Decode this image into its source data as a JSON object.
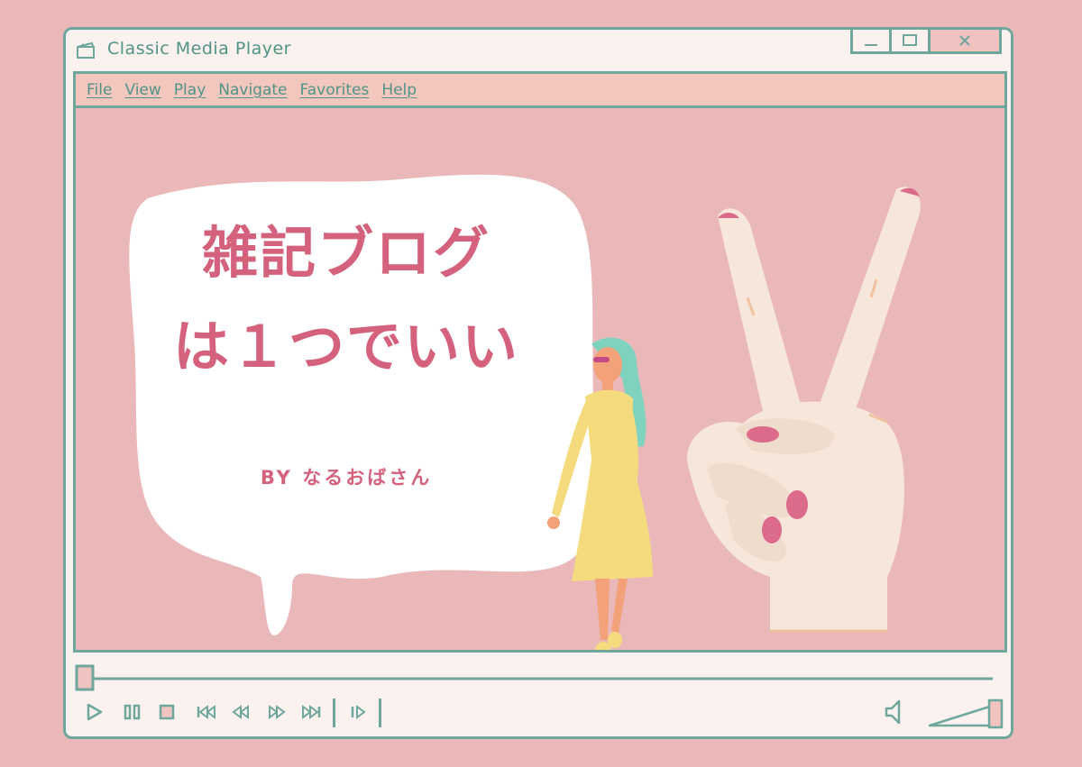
{
  "window": {
    "title": "Classic Media Player",
    "controls": {
      "minimize": "minimize",
      "maximize": "maximize",
      "close": "close"
    }
  },
  "menu": [
    {
      "label": "File"
    },
    {
      "label": "View"
    },
    {
      "label": "Play"
    },
    {
      "label": "Navigate"
    },
    {
      "label": "Favorites"
    },
    {
      "label": "Help"
    }
  ],
  "content": {
    "line1": "雑記ブログ",
    "line2": "は１つでいい",
    "byline": "BY なるおばさん"
  },
  "player": {
    "progress": 0.0,
    "volume": 1.0,
    "icons": [
      "play-icon",
      "pause-icon",
      "stop-icon",
      "skip-back-icon",
      "rewind-icon",
      "fast-forward-icon",
      "skip-forward-icon",
      "step-frame-icon",
      "speaker-icon"
    ]
  },
  "colors": {
    "accent": "#6fa79c",
    "background": "#ebb8b9",
    "headline": "#d5627d",
    "window": "#fbf2ef"
  }
}
